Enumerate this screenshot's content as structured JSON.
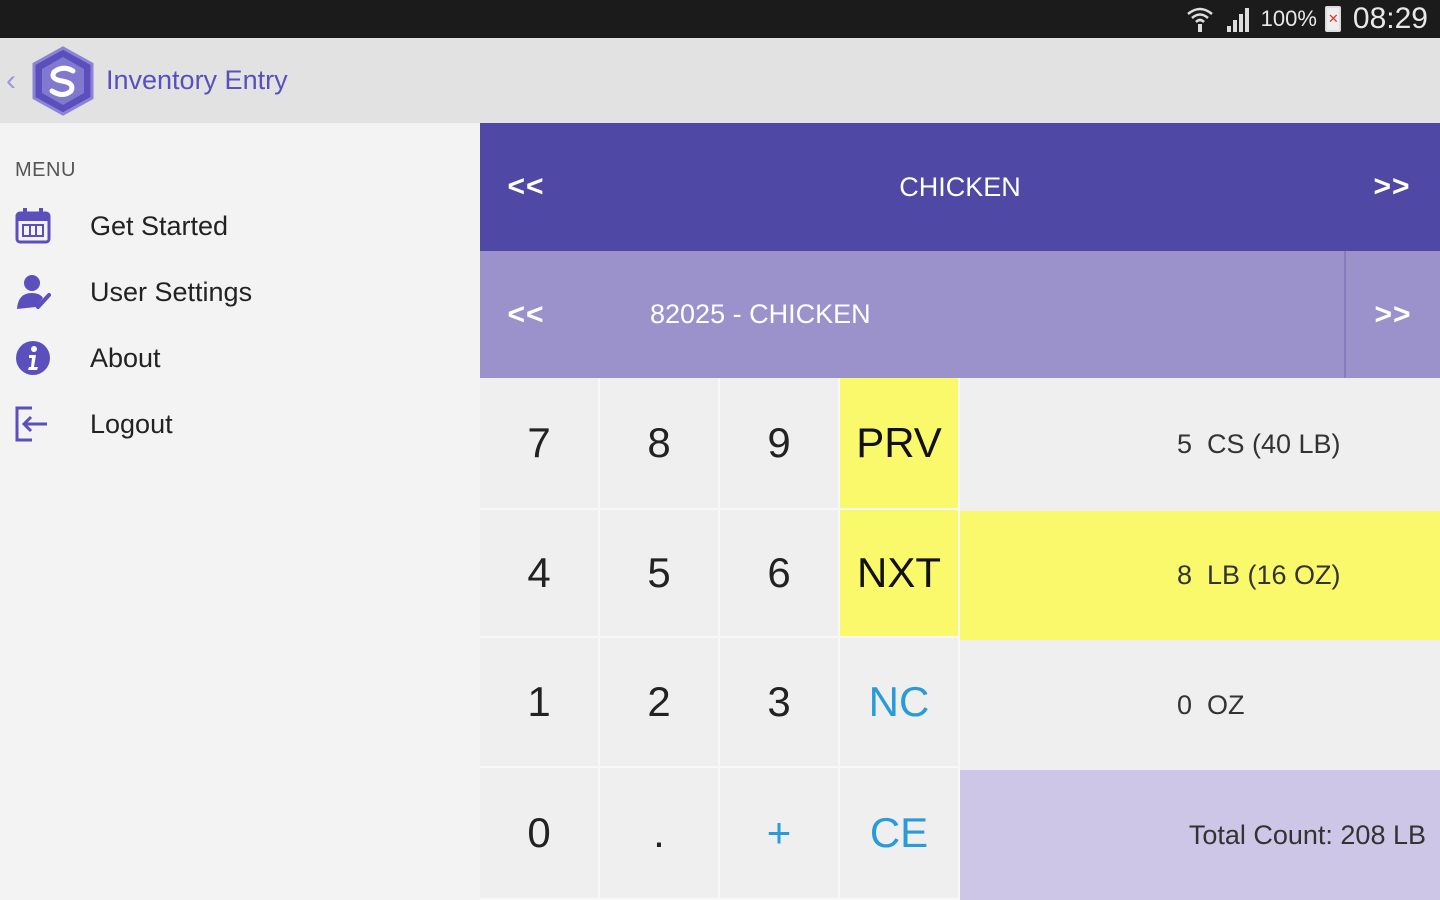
{
  "status": {
    "battery_pct": "100%",
    "time": "08:29"
  },
  "app": {
    "title": "Inventory Entry"
  },
  "sidebar": {
    "header": "MENU",
    "items": [
      {
        "label": "Get Started",
        "icon": "calendar-icon"
      },
      {
        "label": "User Settings",
        "icon": "user-settings-icon"
      },
      {
        "label": "About",
        "icon": "info-icon"
      },
      {
        "label": "Logout",
        "icon": "logout-icon"
      }
    ]
  },
  "category": {
    "prev": "<<",
    "title": "CHICKEN",
    "next": ">>"
  },
  "item": {
    "prev": "<<",
    "title": "82025 - CHICKEN",
    "next": ">>"
  },
  "keypad": {
    "keys": [
      "7",
      "8",
      "9",
      "PRV",
      "4",
      "5",
      "6",
      "NXT",
      "1",
      "2",
      "3",
      "NC",
      "0",
      ".",
      "+",
      "CE"
    ]
  },
  "quantities": [
    {
      "value": "5",
      "unit": "CS (40 LB)"
    },
    {
      "value": "8",
      "unit": "LB (16 OZ)"
    },
    {
      "value": "0",
      "unit": "OZ"
    }
  ],
  "total": "Total Count: 208 LB",
  "colors": {
    "primary": "#4f48a5",
    "secondary": "#9b92cc",
    "highlight": "#f9f96b",
    "total_bg": "#cdc6e6",
    "accent_blue": "#2b9bd8"
  }
}
